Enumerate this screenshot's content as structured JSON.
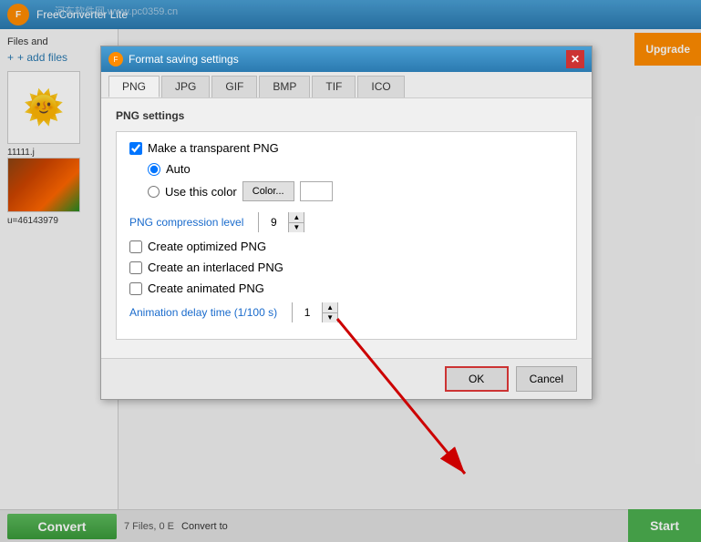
{
  "app": {
    "title": "FreeConverter Lite",
    "watermark": "河东软件网 www.pc0359.cn",
    "upgrade_label": "Upgrade",
    "start_label": "Start",
    "convert_label": "Convert",
    "add_files_label": "+ add files",
    "files_label": "Files and",
    "files_count": "7 Files, 0 E",
    "convert_to_label": "Convert to"
  },
  "modal": {
    "title": "Format saving settings",
    "tabs": [
      "PNG",
      "JPG",
      "GIF",
      "BMP",
      "TIF",
      "ICO"
    ],
    "active_tab": "PNG",
    "section_title": "PNG settings",
    "make_transparent_label": "Make a transparent PNG",
    "make_transparent_checked": true,
    "auto_label": "Auto",
    "auto_selected": true,
    "use_color_label": "Use this color",
    "color_btn_label": "Color...",
    "compression_label": "PNG compression level",
    "compression_value": "9",
    "create_optimized_label": "Create optimized PNG",
    "create_optimized_checked": false,
    "create_interlaced_label": "Create an interlaced PNG",
    "create_interlaced_checked": false,
    "create_animated_label": "Create animated PNG",
    "create_animated_checked": false,
    "animation_delay_label": "Animation delay time (1/100 s)",
    "animation_delay_value": "1",
    "ok_label": "OK",
    "cancel_label": "Cancel"
  },
  "icons": {
    "close": "✕",
    "up_arrow": "▲",
    "down_arrow": "▼",
    "plus": "+",
    "sun": "🌞",
    "check": "✓"
  },
  "colors": {
    "accent_blue": "#2b7ab0",
    "accent_orange": "#ff8c00",
    "accent_green": "#4caf50",
    "red_arrow": "#cc0000",
    "highlight_red": "#cc3333"
  }
}
